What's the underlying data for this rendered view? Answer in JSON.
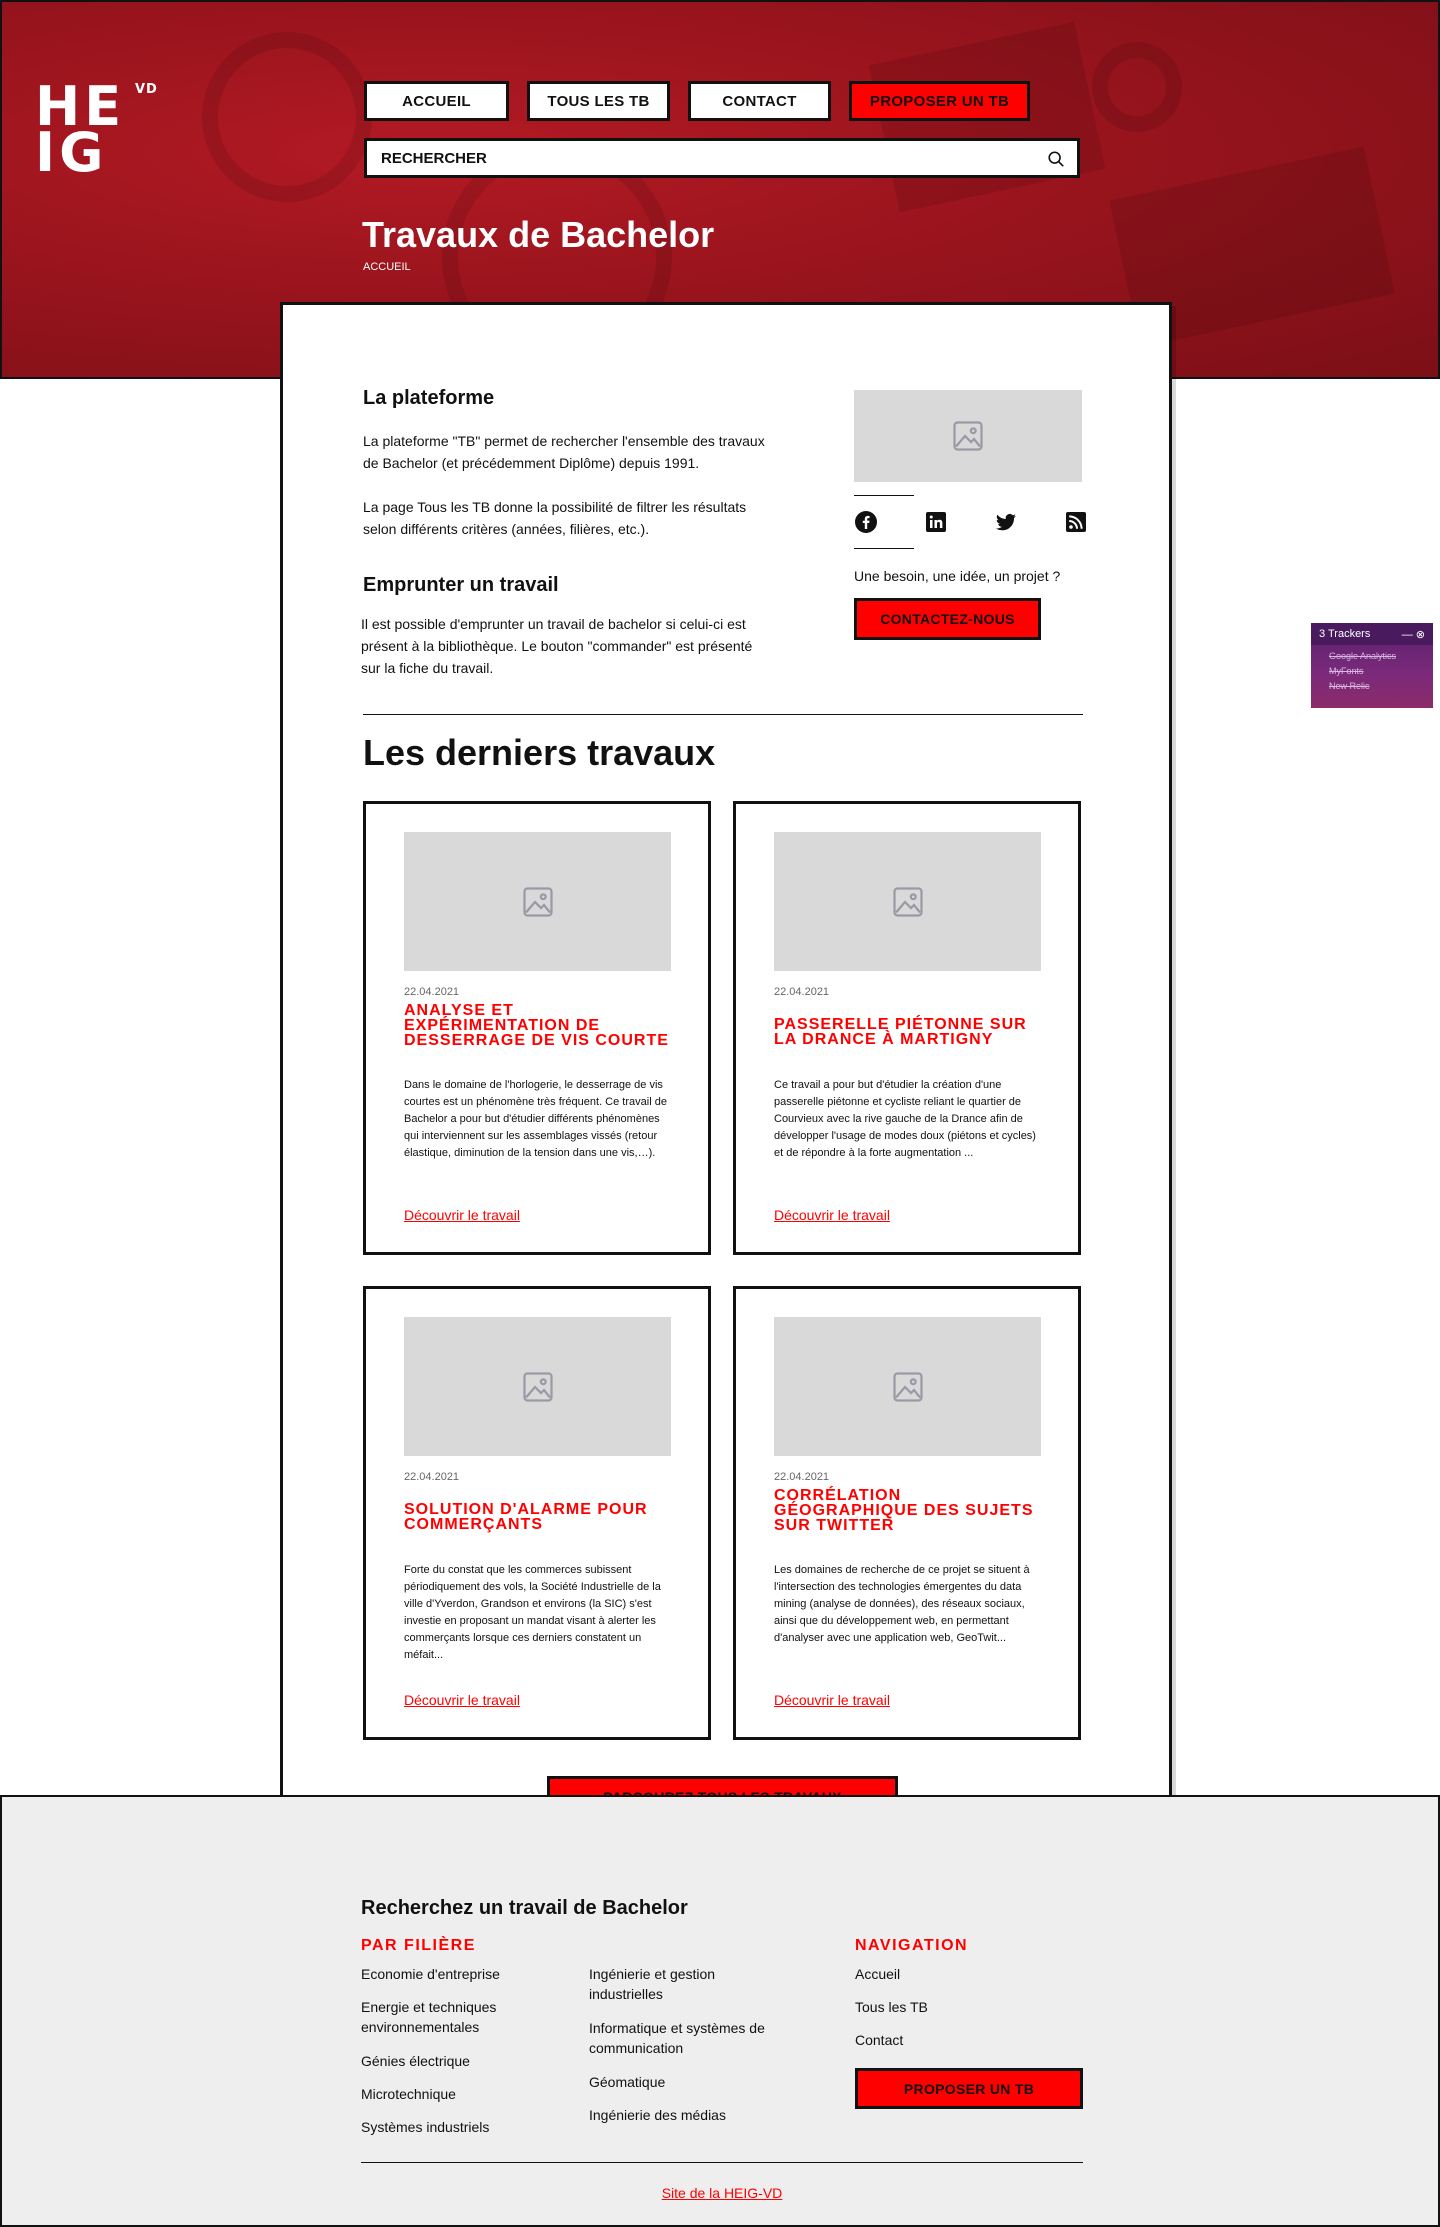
{
  "brand": {
    "logo_line1": "HE",
    "logo_line2": "IG",
    "logo_suffix": "VD"
  },
  "nav": {
    "items": [
      "ACCUEIL",
      "TOUS LES TB",
      "CONTACT"
    ],
    "propose": "PROPOSER UN TB",
    "search_placeholder": "RECHERCHER"
  },
  "hero": {
    "title": "Travaux de Bachelor",
    "breadcrumb": "ACCUEIL"
  },
  "platform": {
    "heading": "La plateforme",
    "text1": "La plateforme \"TB\" permet de rechercher l'ensemble des travaux de Bachelor (et précédemment Diplôme) depuis 1991.",
    "text2": "La page Tous les TB donne la possibilité de filtrer les résultats selon différents critères (années, filières, etc.)."
  },
  "borrow": {
    "heading": "Emprunter un travail",
    "text": "Il est possible d'emprunter un travail de bachelor si celui-ci est présent à la bibliothèque. Le bouton \"commander\" est présenté sur la fiche du travail."
  },
  "sidebar": {
    "social": [
      "facebook-icon",
      "linkedin-icon",
      "twitter-icon",
      "rss-icon"
    ],
    "tagline": "Une besoin, une idée, un projet ?",
    "contact": "CONTACTEZ-NOUS"
  },
  "latest": {
    "heading": "Les derniers travaux",
    "link_label": "Découvrir le travail",
    "cards": [
      {
        "date": "22.04.2021",
        "title": "ANALYSE ET EXPÉRIMENTATION DE DESSERRAGE DE VIS COURTE",
        "desc": "Dans le domaine de l'horlogerie, le desserrage de vis courtes est un phénomène très fréquent. Ce travail de Bachelor a pour but d'étudier différents phénomènes qui interviennent sur les assemblages vissés (retour élastique, diminution de la tension dans une vis,…)."
      },
      {
        "date": "22.04.2021",
        "title": "PASSERELLE PIÉTONNE SUR LA DRANCE À MARTIGNY",
        "desc": "Ce travail a pour but d'étudier la création d'une passerelle piétonne et cycliste reliant le quartier de Courvieux avec la rive gauche de la Drance afin de développer l'usage de modes doux (piétons et cycles) et de répondre à la forte augmentation ..."
      },
      {
        "date": "22.04.2021",
        "title": "SOLUTION D'ALARME POUR COMMERÇANTS",
        "desc": "Forte du constat que les commerces subissent périodiquement des vols, la Société Industrielle de la ville d'Yverdon, Grandson et environs (la SIC) s'est investie en proposant un mandat visant à alerter les commerçants lorsque ces derniers constatent un méfait..."
      },
      {
        "date": "22.04.2021",
        "title": "CORRÉLATION GÉOGRAPHIQUE DES SUJETS SUR TWITTER",
        "desc": "Les domaines de recherche de ce projet se situent à l'intersection des technologies émergentes du data mining (analyse de données), des réseaux sociaux, ainsi que du développement web, en permettant d'analyser avec une application web, GeoTwit..."
      }
    ],
    "browse_all": "PARCOUREZ TOUS LES TRAVAUX"
  },
  "footer": {
    "heading": "Recherchez un travail de Bachelor",
    "by_field": "PAR FILIÈRE",
    "fields_col1": [
      "Economie d'entreprise",
      "Energie et techniques environnementales",
      "Génies électrique",
      "Microtechnique",
      "Systèmes industriels"
    ],
    "fields_col2": [
      "Ingénierie et gestion industrielles",
      "Informatique et systèmes de communication",
      "Géomatique",
      "Ingénierie des médias"
    ],
    "navigation": "NAVIGATION",
    "nav_links": [
      "Accueil",
      "Tous les TB",
      "Contact"
    ],
    "propose": "PROPOSER UN TB",
    "site_link": "Site de la HEIG-VD"
  },
  "trackers": {
    "title": "3 Trackers",
    "items": [
      "Google Analytics",
      "MyFonts",
      "New Relic"
    ]
  }
}
